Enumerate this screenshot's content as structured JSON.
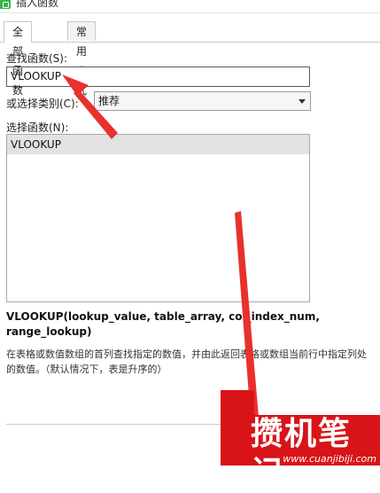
{
  "window": {
    "title": "插入函数"
  },
  "tabs": [
    {
      "label": "全部函数",
      "active": true
    },
    {
      "label": "常用公式",
      "active": false
    }
  ],
  "search": {
    "label": "查找函数(S):",
    "value": "VLOOKUP"
  },
  "category": {
    "label": "或选择类别(C):",
    "selected": "推荐"
  },
  "function_list": {
    "label": "选择函数(N):",
    "items": [
      "VLOOKUP"
    ]
  },
  "signature": "VLOOKUP(lookup_value, table_array, col_index_num, range_lookup)",
  "description": "在表格或数值数组的首列查找指定的数值，并由此返回表格或数组当前行中指定列处的数值。（默认情况下，表是升序的）",
  "watermark": {
    "text": "攒机笔记",
    "url": "www.cuanjibiji.com"
  },
  "colors": {
    "arrow": "#e8312d",
    "watermark": "#d81418"
  }
}
